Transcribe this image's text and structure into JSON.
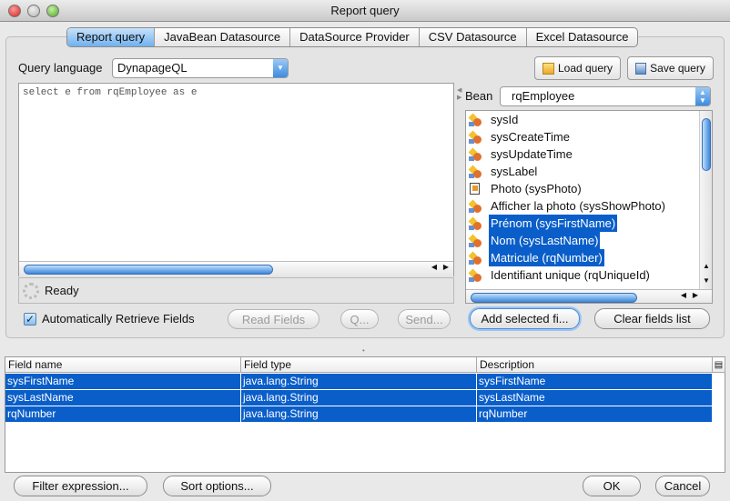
{
  "window": {
    "title": "Report query"
  },
  "tabs": [
    {
      "label": "Report query",
      "active": true
    },
    {
      "label": "JavaBean Datasource"
    },
    {
      "label": "DataSource Provider"
    },
    {
      "label": "CSV Datasource"
    },
    {
      "label": "Excel Datasource"
    }
  ],
  "query": {
    "language_label": "Query language",
    "language_value": "DynapageQL",
    "text": "select e from rqEmployee as e",
    "load_label": "Load query",
    "save_label": "Save query",
    "status": "Ready",
    "auto_retrieve_label": "Automatically Retrieve Fields",
    "auto_retrieve_checked": true,
    "read_fields_label": "Read Fields",
    "q_label": "Q...",
    "send_label": "Send..."
  },
  "bean": {
    "label": "Bean",
    "value": "rqEmployee",
    "items": [
      {
        "label": "sysId",
        "icon": "property-icon",
        "selected": false
      },
      {
        "label": "sysCreateTime",
        "icon": "property-icon",
        "selected": false
      },
      {
        "label": "sysUpdateTime",
        "icon": "property-icon",
        "selected": false
      },
      {
        "label": "sysLabel",
        "icon": "property-icon",
        "selected": false
      },
      {
        "label": "Photo (sysPhoto)",
        "icon": "image-property-icon",
        "selected": false
      },
      {
        "label": "Afficher la photo (sysShowPhoto)",
        "icon": "property-icon",
        "selected": false
      },
      {
        "label": "Prénom (sysFirstName)",
        "icon": "property-icon",
        "selected": true
      },
      {
        "label": "Nom (sysLastName)",
        "icon": "property-icon",
        "selected": true
      },
      {
        "label": "Matricule (rqNumber)",
        "icon": "property-icon",
        "selected": true
      },
      {
        "label": "Identifiant unique (rqUniqueId)",
        "icon": "property-icon",
        "selected": false
      }
    ],
    "add_label": "Add selected fi...",
    "clear_label": "Clear fields list"
  },
  "fields": {
    "columns": [
      "Field name",
      "Field type",
      "Description"
    ],
    "rows": [
      [
        "sysFirstName",
        "java.lang.String",
        "sysFirstName"
      ],
      [
        "sysLastName",
        "java.lang.String",
        "sysLastName"
      ],
      [
        "rqNumber",
        "java.lang.String",
        "rqNumber"
      ]
    ]
  },
  "footer": {
    "filter_label": "Filter expression...",
    "sort_label": "Sort options...",
    "ok_label": "OK",
    "cancel_label": "Cancel"
  },
  "colors": {
    "selection": "#0a5ec9",
    "accent": "#3d8be0"
  }
}
